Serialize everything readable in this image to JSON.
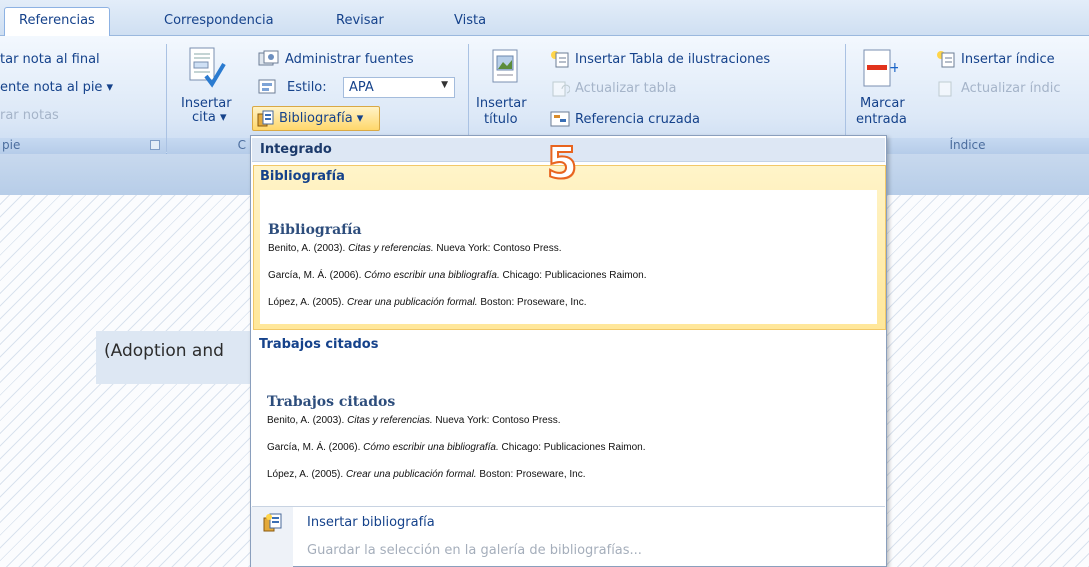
{
  "tabs": [
    {
      "label": "Referencias",
      "active": true
    },
    {
      "label": "Correspondencia",
      "active": false
    },
    {
      "label": "Revisar",
      "active": false
    },
    {
      "label": "Vista",
      "active": false
    }
  ],
  "ribbon": {
    "footnotes": {
      "insert_endnote": "tar nota al final",
      "next_footnote": "ente nota al pie ▾",
      "show_notes": "rar notas",
      "group_title": "pie"
    },
    "citations": {
      "insert_citation_line1": "Insertar",
      "insert_citation_line2": "cita ▾",
      "manage_sources": "Administrar fuentes",
      "style_label": "Estilo:",
      "style_value": "APA",
      "bibliography_button": "Bibliografía ▾",
      "group_title_partial": "C"
    },
    "captions": {
      "insert_caption_line1": "Insertar",
      "insert_caption_line2": "título",
      "insert_table_of_figures": "Insertar Tabla de ilustraciones",
      "update_table": "Actualizar tabla",
      "cross_reference": "Referencia cruzada"
    },
    "index": {
      "mark_entry_line1": "Marcar",
      "mark_entry_line2": "entrada",
      "insert_index": "Insertar índice",
      "update_index": "Actualizar índic",
      "group_title": "Índice"
    }
  },
  "document": {
    "visible_text": "(Adoption and"
  },
  "annotation_number": "5",
  "bibliography_menu": {
    "section_header": "Integrado",
    "items": [
      {
        "category": "Bibliografía",
        "preview_title": "Bibliografía",
        "entries": [
          {
            "prefix": "Benito, A. (2003). ",
            "title": "Citas y referencias.",
            "suffix": " Nueva York: Contoso Press."
          },
          {
            "prefix": "García, M. Á. (2006). ",
            "title": "Cómo escribir una bibliografía.",
            "suffix": " Chicago: Publicaciones Raimon."
          },
          {
            "prefix": "López, A. (2005). ",
            "title": "Crear una publicación formal.",
            "suffix": " Boston: Proseware, Inc."
          }
        ]
      },
      {
        "category": "Trabajos citados",
        "preview_title": "Trabajos citados",
        "entries": [
          {
            "prefix": "Benito, A. (2003). ",
            "title": "Citas y referencias.",
            "suffix": " Nueva York: Contoso Press."
          },
          {
            "prefix": "García, M. Á. (2006). ",
            "title": "Cómo escribir una bibliografía.",
            "suffix": " Chicago: Publicaciones Raimon."
          },
          {
            "prefix": "López, A. (2005). ",
            "title": "Crear una publicación formal.",
            "suffix": " Boston: Proseware, Inc."
          }
        ]
      }
    ],
    "insert_bibliography": "Insertar bibliografía",
    "save_selection": "Guardar la selección en la galería de bibliografías..."
  },
  "colors": {
    "ribbon_text": "#15428b",
    "highlight_border": "#f2c868",
    "annotation": "#e8641e"
  }
}
